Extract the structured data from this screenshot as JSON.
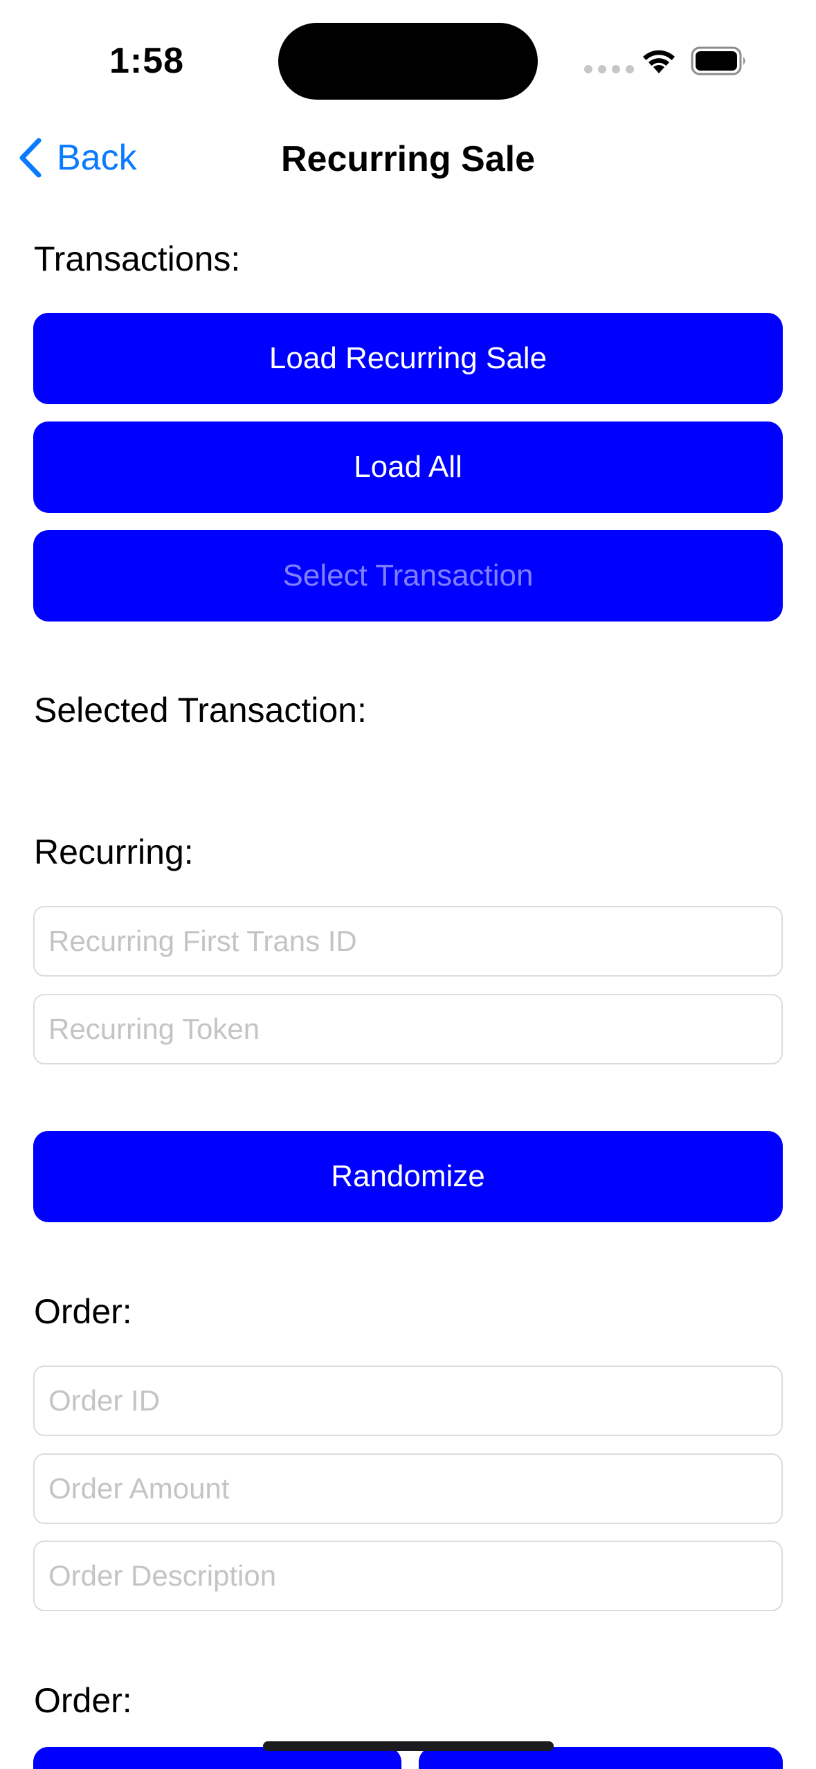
{
  "status_bar": {
    "time": "1:58"
  },
  "nav": {
    "back_label": "Back",
    "title": "Recurring Sale"
  },
  "transactions": {
    "label": "Transactions:",
    "load_recurring_sale": "Load Recurring Sale",
    "load_all": "Load All",
    "select_transaction": "Select Transaction"
  },
  "selected_transaction": {
    "label": "Selected Transaction:"
  },
  "recurring": {
    "label": "Recurring:",
    "first_trans_id": {
      "value": "",
      "placeholder": "Recurring First Trans ID"
    },
    "token": {
      "value": "",
      "placeholder": "Recurring Token"
    },
    "randomize": "Randomize"
  },
  "order": {
    "label": "Order:",
    "order_id": {
      "value": "",
      "placeholder": "Order ID"
    },
    "order_amount": {
      "value": "",
      "placeholder": "Order Amount"
    },
    "order_description": {
      "value": "",
      "placeholder": "Order Description"
    }
  },
  "order_2": {
    "label": "Order:"
  },
  "colors": {
    "accent_blue": "#0000ff",
    "link_blue": "#0a7aff"
  }
}
